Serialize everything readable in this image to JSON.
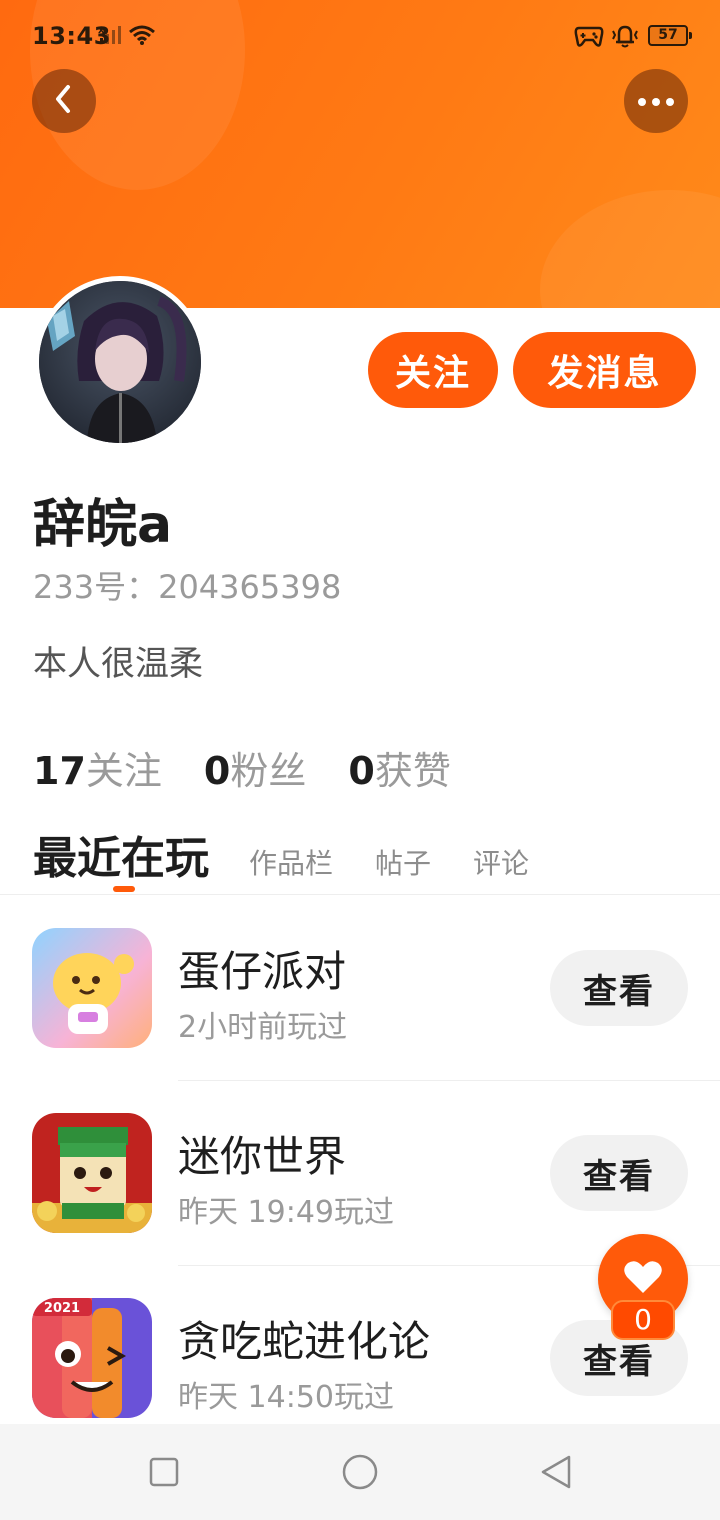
{
  "status_bar": {
    "time": "13:43",
    "battery": "57",
    "icons": [
      "signal-icon",
      "wifi-icon",
      "game-mode-icon",
      "vibrate-icon",
      "battery-icon"
    ]
  },
  "header": {
    "back_icon": "chevron-left-icon",
    "more_icon": "more-dots-icon"
  },
  "profile": {
    "follow_label": "关注",
    "message_label": "发消息",
    "username": "辞皖a",
    "id_text": "233号：204365398",
    "bio": "本人很温柔"
  },
  "stats": [
    {
      "count": "17",
      "label": "关注"
    },
    {
      "count": "0",
      "label": "粉丝"
    },
    {
      "count": "0",
      "label": "获赞"
    }
  ],
  "tabs": [
    {
      "label": "最近在玩",
      "active": true
    },
    {
      "label": "作品栏",
      "active": false
    },
    {
      "label": "帖子",
      "active": false
    },
    {
      "label": "评论",
      "active": false
    }
  ],
  "games": [
    {
      "name": "蛋仔派对",
      "played": "2小时前玩过",
      "button": "查看"
    },
    {
      "name": "迷你世界",
      "played": "昨天 19:49玩过",
      "button": "查看"
    },
    {
      "name": "贪吃蛇进化论",
      "played": "昨天 14:50玩过",
      "button": "查看",
      "badge": "2021"
    }
  ],
  "like_fab": {
    "icon": "heart-icon",
    "count": "0"
  },
  "colors": {
    "brand_orange": "#ff5a0a",
    "banner_orange": "#ff7a14"
  }
}
